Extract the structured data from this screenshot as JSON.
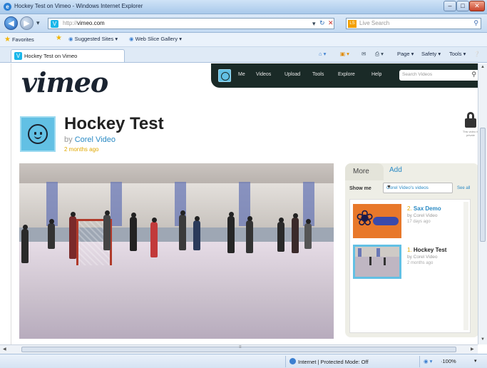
{
  "window": {
    "title": "Hockey Test on Vimeo - Windows Internet Explorer"
  },
  "address": {
    "protocol": "http://",
    "host": "vimeo.com",
    "search_placeholder": "Live Search"
  },
  "favorites_bar": {
    "favorites_label": "Favorites",
    "items": [
      "Suggested Sites ▾",
      "Web Slice Gallery ▾"
    ]
  },
  "tab": {
    "title": "Hockey Test on Vimeo"
  },
  "command_bar": {
    "page": "Page ▾",
    "safety": "Safety ▾",
    "tools": "Tools ▾"
  },
  "site": {
    "logo": "vimeo",
    "nav": [
      "Me",
      "Videos",
      "Upload",
      "Tools",
      "Explore",
      "Help"
    ],
    "search_placeholder": "Search Videos"
  },
  "video": {
    "title": "Hockey Test",
    "by_prefix": "by",
    "author": "Corel Video",
    "age": "2 months ago",
    "privacy_caption": "This video is private"
  },
  "sidebar": {
    "tab_more": "More",
    "tab_add": "Add",
    "show_me_label": "Show me",
    "show_me_value": "Corel Video's videos",
    "see_all": "See all",
    "items": [
      {
        "num": "2.",
        "title": "Sax Demo",
        "by": "by Corel Video",
        "meta": "17 days ago"
      },
      {
        "num": "1.",
        "title": "Hockey Test",
        "by": "by Corel Video",
        "meta": "2 months ago"
      }
    ]
  },
  "status_bar": {
    "zone": "Internet | Protected Mode: Off",
    "zoom": "·100%"
  },
  "colors": {
    "vimeo_blue": "#1ab7ea",
    "nav_dark": "#1a2a27",
    "link": "#2a8ac4",
    "ie_chrome": "#c4daf2"
  }
}
